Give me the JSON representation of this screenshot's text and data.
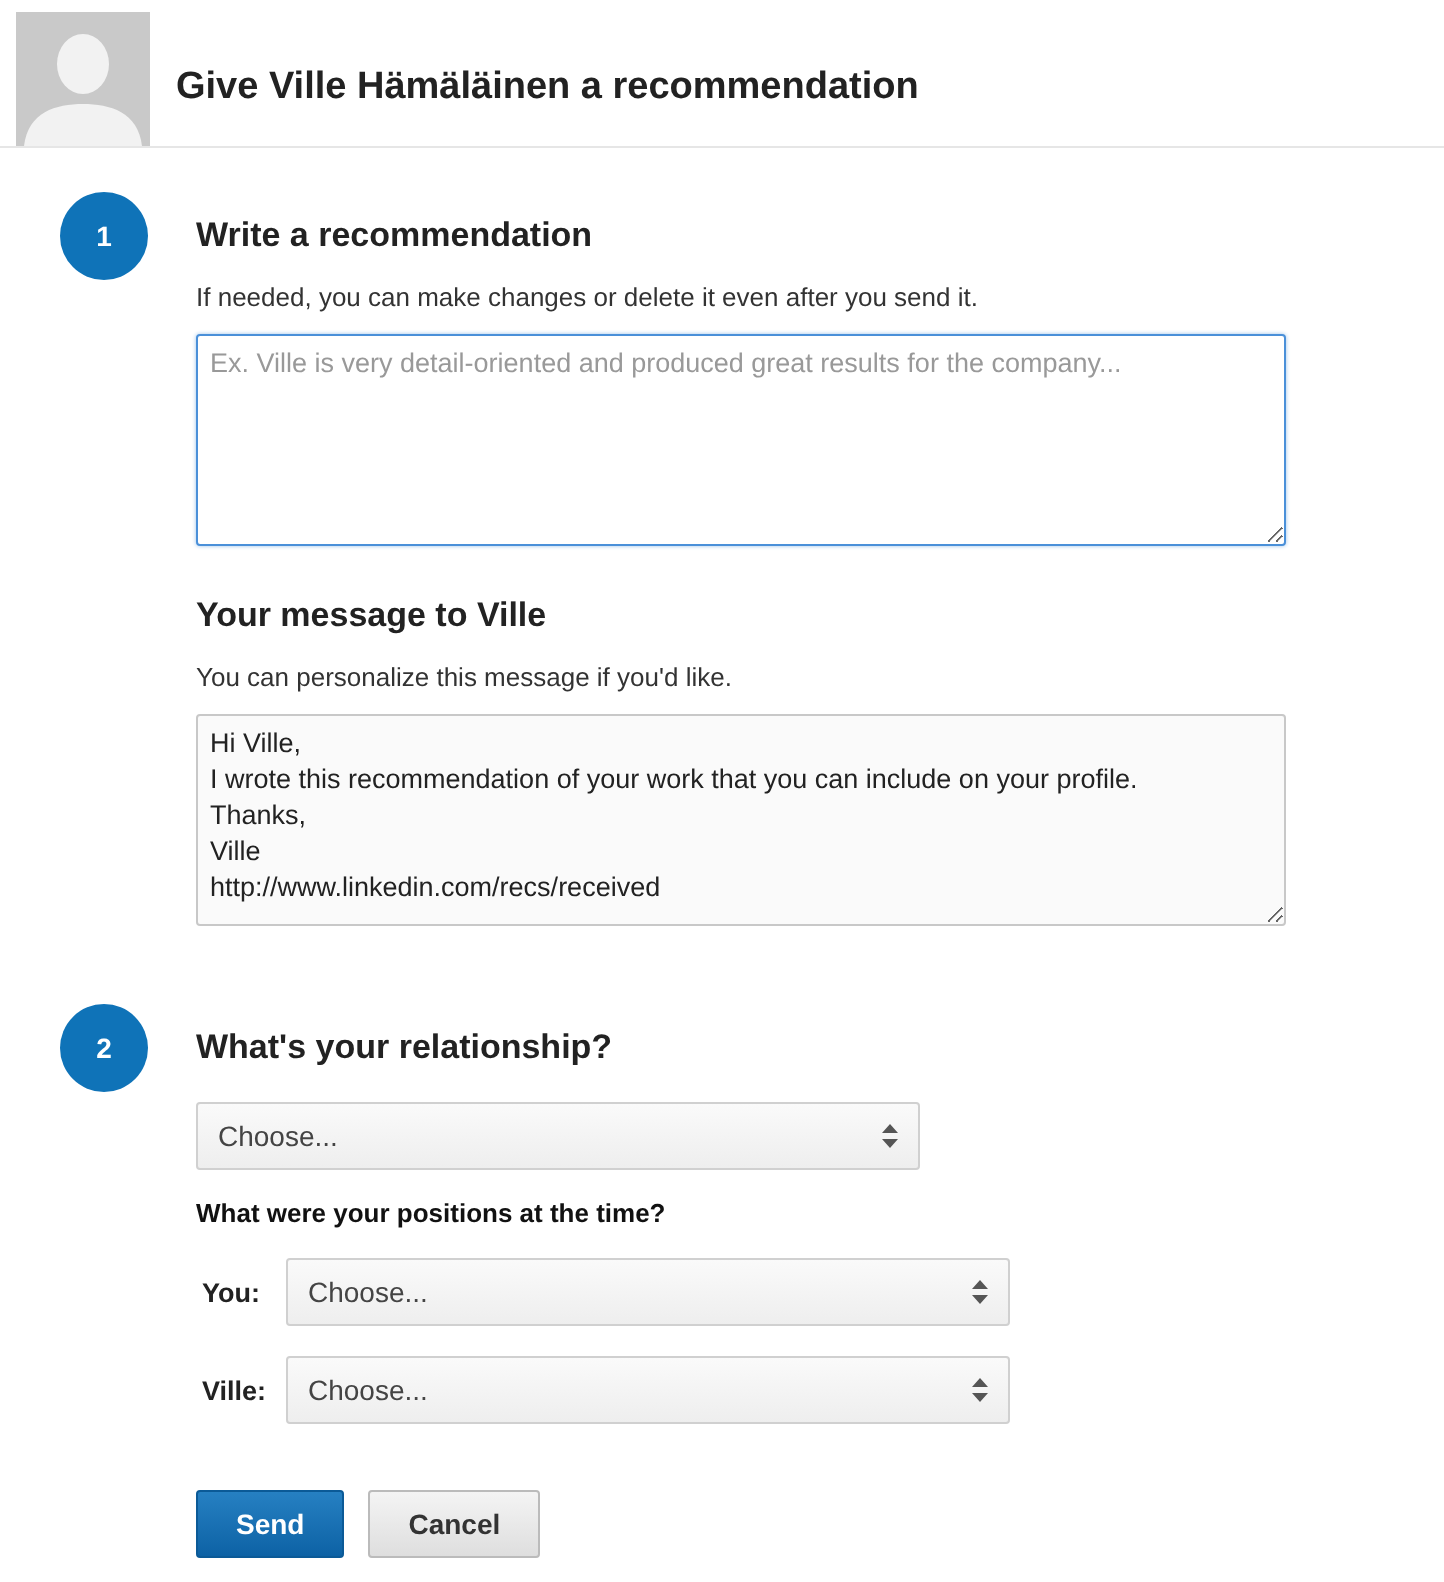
{
  "header": {
    "title": "Give Ville Hämäläinen a recommendation"
  },
  "step_1": {
    "number": "1",
    "sections": [
      {
        "heading": "Write a recommendation",
        "hint": "If needed, you can make changes or delete it even after you send it.",
        "field": {
          "placeholder": "Ex. Ville is very detail-oriented and produced great results for the company...",
          "focused": true
        }
      },
      {
        "heading": "Your message to Ville",
        "hint": "You can personalize this message if you'd like.",
        "field": {
          "value": "Hi Ville,\nI wrote this recommendation of your work that you can include on your profile.\nThanks,\nVille\nhttp://www.linkedin.com/recs/received",
          "focused": false
        }
      }
    ]
  },
  "step_2": {
    "number": "2",
    "heading": "What's your relationship?",
    "relationship": {
      "value": "Choose..."
    },
    "subheading": "What were your positions at the time?",
    "positions": [
      {
        "label": "You:",
        "value": "Choose..."
      },
      {
        "label": "Ville:",
        "value": "Choose..."
      }
    ]
  },
  "buttons": [
    {
      "label": "Send",
      "kind": "primary"
    },
    {
      "label": "Cancel",
      "kind": "secondary"
    }
  ]
}
